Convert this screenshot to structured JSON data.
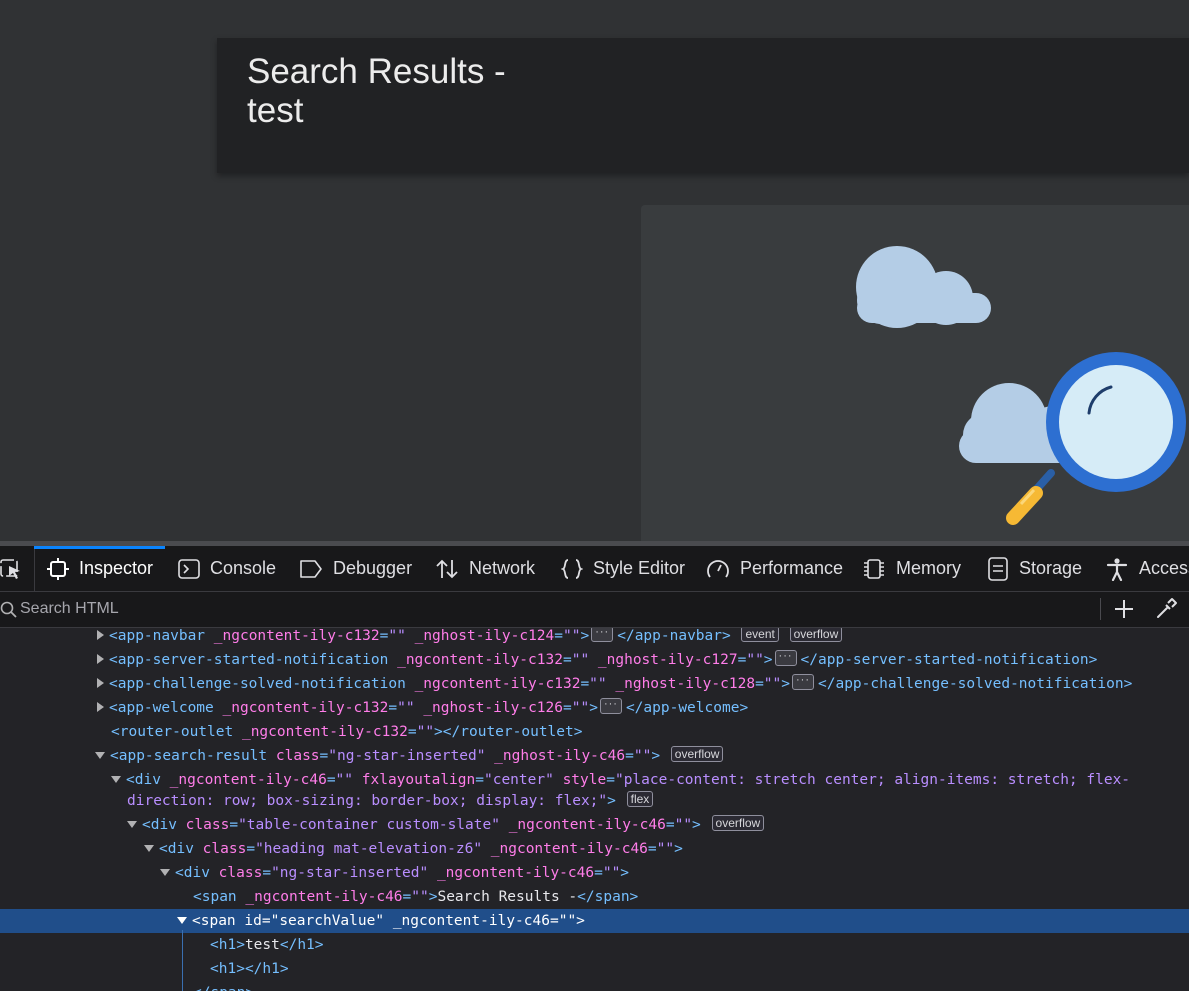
{
  "page": {
    "heading_line1": "Search Results -",
    "heading_line2": "test"
  },
  "devtools": {
    "tabs": [
      {
        "label": "Inspector",
        "icon": "inspector-icon",
        "active": true
      },
      {
        "label": "Console",
        "icon": "console-icon"
      },
      {
        "label": "Debugger",
        "icon": "debugger-icon"
      },
      {
        "label": "Network",
        "icon": "network-icon"
      },
      {
        "label": "Style Editor",
        "icon": "braces-icon"
      },
      {
        "label": "Performance",
        "icon": "gauge-icon"
      },
      {
        "label": "Memory",
        "icon": "chip-icon"
      },
      {
        "label": "Storage",
        "icon": "storage-icon"
      },
      {
        "label": "Access",
        "icon": "accessibility-icon"
      }
    ],
    "search_placeholder": "Search HTML",
    "accent_color": "#0a84ff",
    "selection_color": "#204e8a",
    "tree": {
      "n0": {
        "tag": "app-navbar",
        "attrs": [
          [
            "_ngcontent-ily-c132",
            ""
          ],
          [
            "_nghost-ily-c124",
            ""
          ]
        ],
        "close": "app-navbar",
        "badges": [
          "event",
          "overflow"
        ]
      },
      "n1": {
        "tag": "app-server-started-notification",
        "attrs": [
          [
            "_ngcontent-ily-c132",
            ""
          ],
          [
            "_nghost-ily-c127",
            ""
          ]
        ],
        "close": "app-server-started-notification"
      },
      "n2": {
        "tag": "app-challenge-solved-notification",
        "attrs": [
          [
            "_ngcontent-ily-c132",
            ""
          ],
          [
            "_nghost-ily-c128",
            ""
          ]
        ],
        "close": "app-challenge-solved-notification"
      },
      "n3": {
        "tag": "app-welcome",
        "attrs": [
          [
            "_ngcontent-ily-c132",
            ""
          ],
          [
            "_nghost-ily-c126",
            ""
          ]
        ],
        "close": "app-welcome"
      },
      "n4": {
        "tag": "router-outlet",
        "attrs": [
          [
            "_ngcontent-ily-c132",
            ""
          ]
        ],
        "close": "router-outlet"
      },
      "n5": {
        "tag": "app-search-result",
        "attrs": [
          [
            "class",
            "ng-star-inserted"
          ],
          [
            "_nghost-ily-c46",
            ""
          ]
        ],
        "badges": [
          "overflow"
        ]
      },
      "n6": {
        "tag": "div",
        "line1_attrs": [
          [
            "_ngcontent-ily-c46",
            ""
          ],
          [
            "fxlayoutalign",
            "center"
          ]
        ],
        "style_name": "style",
        "style_part1": "place-content: stretch center; align-items: stretch; flex-",
        "style_part2": "direction: row; box-sizing: border-box; display: flex;",
        "badges": [
          "flex"
        ]
      },
      "n7": {
        "tag": "div",
        "attrs": [
          [
            "class",
            "table-container custom-slate"
          ],
          [
            "_ngcontent-ily-c46",
            ""
          ]
        ],
        "badges": [
          "overflow"
        ]
      },
      "n8": {
        "tag": "div",
        "attrs": [
          [
            "class",
            "heading mat-elevation-z6"
          ],
          [
            "_ngcontent-ily-c46",
            ""
          ]
        ]
      },
      "n9": {
        "tag": "div",
        "attrs": [
          [
            "class",
            "ng-star-inserted"
          ],
          [
            "_ngcontent-ily-c46",
            ""
          ]
        ]
      },
      "n10": {
        "tag": "span",
        "attrs": [
          [
            "_ngcontent-ily-c46",
            ""
          ]
        ],
        "text": "Search Results -",
        "close": "span"
      },
      "n11": {
        "tag": "span",
        "attrs": [
          [
            "id",
            "searchValue"
          ],
          [
            "_ngcontent-ily-c46",
            ""
          ]
        ]
      },
      "n12": {
        "tag": "h1",
        "text": "test",
        "close": "h1"
      },
      "n13": {
        "tag": "h1",
        "text": "",
        "close": "h1"
      },
      "n14": {
        "close": "span"
      }
    }
  }
}
